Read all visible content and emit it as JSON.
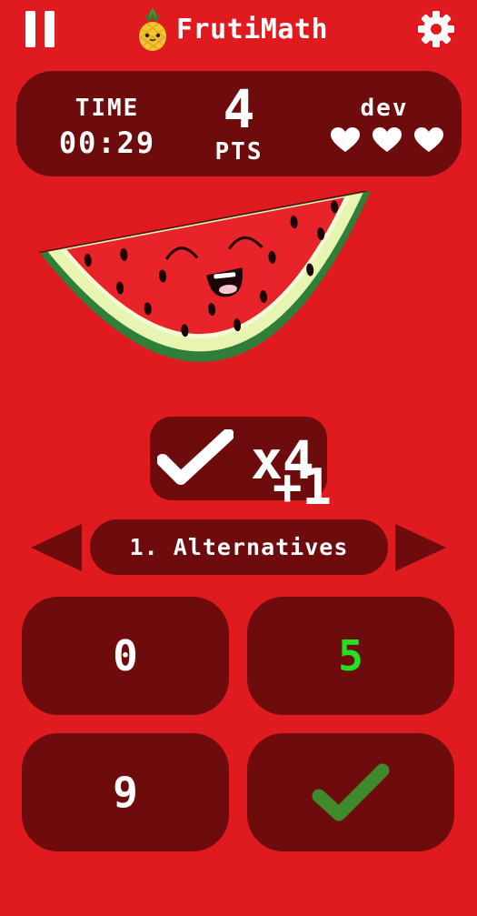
{
  "header": {
    "app_title": "FrutiMath",
    "pause_icon": "pause-icon",
    "settings_icon": "gear-icon",
    "logo_icon": "pineapple-icon"
  },
  "stats": {
    "time_label": "TIME",
    "time_value": "00:29",
    "score": "4",
    "score_unit": "PTS",
    "player_name": "dev",
    "lives": 3,
    "life_icon": "heart-icon"
  },
  "fruit": {
    "icon": "watermelon-icon"
  },
  "combo": {
    "icon": "check-icon",
    "multiplier": "x4",
    "bonus": "+1"
  },
  "mode": {
    "label": "1. Alternatives",
    "prev_icon": "arrow-left-icon",
    "next_icon": "arrow-right-icon"
  },
  "answers": [
    {
      "label": "0",
      "color": "#ffffff"
    },
    {
      "label": "5",
      "color": "#22e022"
    },
    {
      "label": "9",
      "color": "#ffffff"
    }
  ],
  "confirm": {
    "icon": "check-icon",
    "color": "#3f8a2c"
  },
  "colors": {
    "background": "#e01b1f",
    "panel": "#6e0b0d",
    "correct": "#22e022"
  }
}
